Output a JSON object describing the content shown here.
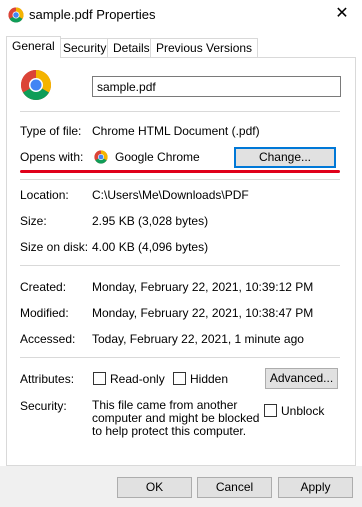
{
  "window": {
    "title": "sample.pdf Properties",
    "close": "✕"
  },
  "tabs": [
    {
      "label": "General",
      "active": true
    },
    {
      "label": "Security"
    },
    {
      "label": "Details"
    },
    {
      "label": "Previous Versions"
    }
  ],
  "file": {
    "name": "sample.pdf"
  },
  "props": {
    "type_label": "Type of file:",
    "type_value": "Chrome HTML Document (.pdf)",
    "opens_label": "Opens with:",
    "opens_value": "Google Chrome",
    "change_label": "Change...",
    "location_label": "Location:",
    "location_value": "C:\\Users\\Me\\Downloads\\PDF",
    "size_label": "Size:",
    "size_value": "2.95 KB (3,028 bytes)",
    "disk_label": "Size on disk:",
    "disk_value": "4.00 KB (4,096 bytes)",
    "created_label": "Created:",
    "created_value": "Monday, February 22, 2021, 10:39:12 PM",
    "modified_label": "Modified:",
    "modified_value": "Monday, February 22, 2021, 10:38:47 PM",
    "accessed_label": "Accessed:",
    "accessed_value": "Today, February 22, 2021, 1 minute ago",
    "attributes_label": "Attributes:",
    "readonly_label": "Read-only",
    "hidden_label": "Hidden",
    "advanced_label": "Advanced...",
    "security_label": "Security:",
    "security_text": "This file came from another computer and might be blocked to help protect this computer.",
    "unblock_label": "Unblock"
  },
  "footer": {
    "ok": "OK",
    "cancel": "Cancel",
    "apply": "Apply"
  },
  "colors": {
    "accent": "#0078d7",
    "highlight": "#e0001a"
  },
  "icons": {
    "app": "chrome-icon"
  }
}
